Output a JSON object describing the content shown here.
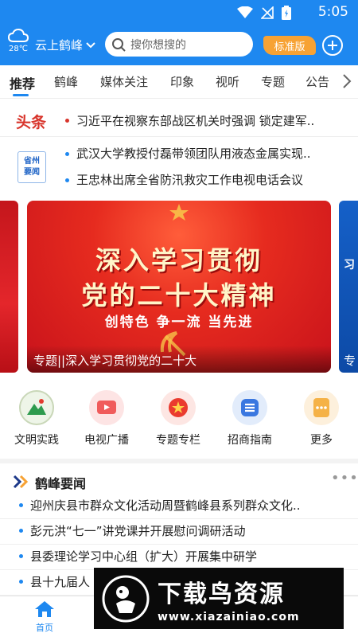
{
  "status_bar": {
    "time": "5:05"
  },
  "header": {
    "weather_temp": "28℃",
    "city": "云上鹤峰",
    "search_placeholder": "搜你想搜的",
    "edition_button": "标准版"
  },
  "tabs": [
    "推荐",
    "鹤峰",
    "媒体关注",
    "印象",
    "视听",
    "专题",
    "公告"
  ],
  "headline": {
    "label": "头条",
    "text": "习近平在视察东部战区机关时强调 锁定建军.."
  },
  "provincial": {
    "badge_line1": "省州",
    "badge_line2": "要闻",
    "items": [
      "武汉大学教授付磊带领团队用液态金属实现..",
      "王忠林出席全省防汛救灾工作电视电话会议"
    ]
  },
  "banner": {
    "line1": "深入学习贯彻",
    "line2": "党的二十大精神",
    "slogan": "创特色 争一流 当先进",
    "caption": "专题||深入学习贯彻党的二十大",
    "side_right_caption": "专",
    "side_right_text": "习"
  },
  "quick_links": [
    {
      "label": "文明实践",
      "icon": "civilization-icon"
    },
    {
      "label": "电视广播",
      "icon": "tv-icon"
    },
    {
      "label": "专题专栏",
      "icon": "star-badge-icon"
    },
    {
      "label": "招商指南",
      "icon": "list-icon"
    },
    {
      "label": "更多",
      "icon": "more-icon"
    }
  ],
  "local_news": {
    "title": "鹤峰要闻",
    "items": [
      "迎州庆县市群众文化活动周暨鹤峰县系列群众文化..",
      "彭元洪“七一”讲党课并开展慰问调研活动",
      "县委理论学习中心组（扩大）开展集中研学",
      "县十九届人"
    ]
  },
  "bottom_nav": [
    {
      "label": "首页",
      "icon": "home-icon"
    },
    {
      "label": "",
      "icon": ""
    },
    {
      "label": "",
      "icon": ""
    },
    {
      "label": "",
      "icon": ""
    },
    {
      "label": "",
      "icon": ""
    }
  ],
  "watermark": {
    "title": "下载鸟资源",
    "url": "www.xiazainiao.com"
  },
  "colors": {
    "brand_blue": "#1e88f0",
    "headline_red": "#d8342b",
    "edition_orange": "#f7a234"
  }
}
